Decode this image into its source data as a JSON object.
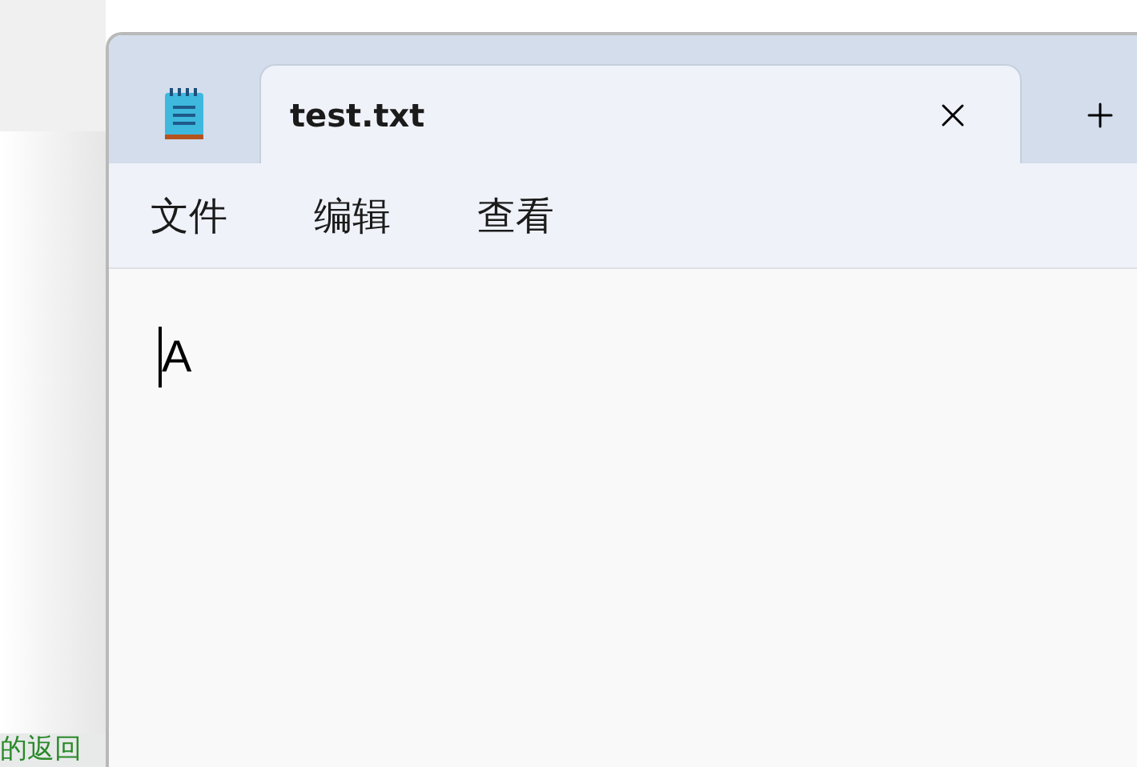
{
  "background_text": "的返回",
  "tabs": [
    {
      "title": "test.txt",
      "selected": true
    }
  ],
  "menu": [
    "文件",
    "编辑",
    "查看"
  ],
  "editor": {
    "text": "A"
  }
}
